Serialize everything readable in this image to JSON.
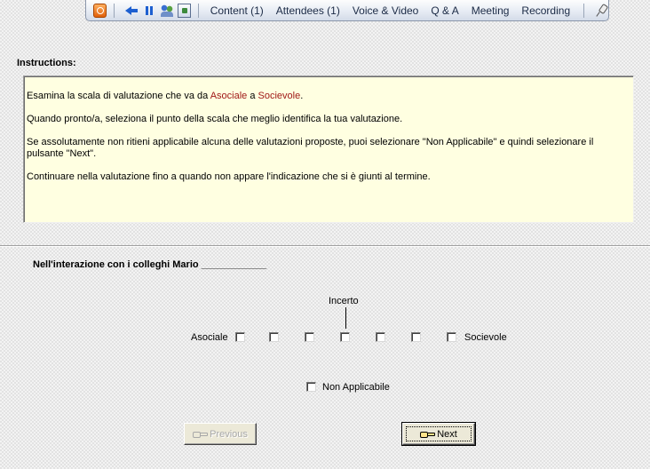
{
  "toolbar": {
    "icons": [
      "home-icon",
      "back-icon",
      "pause-icon",
      "people-icon",
      "share-icon",
      "pin-icon"
    ],
    "menu": [
      "Content (1)",
      "Attendees (1)",
      "Voice & Video",
      "Q & A",
      "Meeting",
      "Recording"
    ]
  },
  "instructions": {
    "title": "Instructions:",
    "p1_before": "Esamina la scala di valutazione che va da ",
    "p1_term1": "Asociale",
    "p1_mid": " a ",
    "p1_term2": "Socievole",
    "p1_after": ".",
    "p2": "Quando pronto/a, seleziona il punto della scala che meglio identifica la tua valutazione.",
    "p3": "Se assolutamente non ritieni applicabile alcuna delle valutazioni proposte, puoi selezionare \"Non Applicabile\" e quindi selezionare il pulsante \"Next\".",
    "p4": "Continuare nella valutazione fino a quando non appare l'indicazione che si è giunti al termine.",
    "highlight_color": "#a01818"
  },
  "question": "Nell'interazione con i colleghi Mario ____________",
  "scale": {
    "midpoint_label": "Incerto",
    "left_label": "Asociale",
    "right_label": "Socievole",
    "points": 7
  },
  "not_applicable_label": "Non Applicabile",
  "buttons": {
    "previous": "Previous",
    "next": "Next"
  }
}
